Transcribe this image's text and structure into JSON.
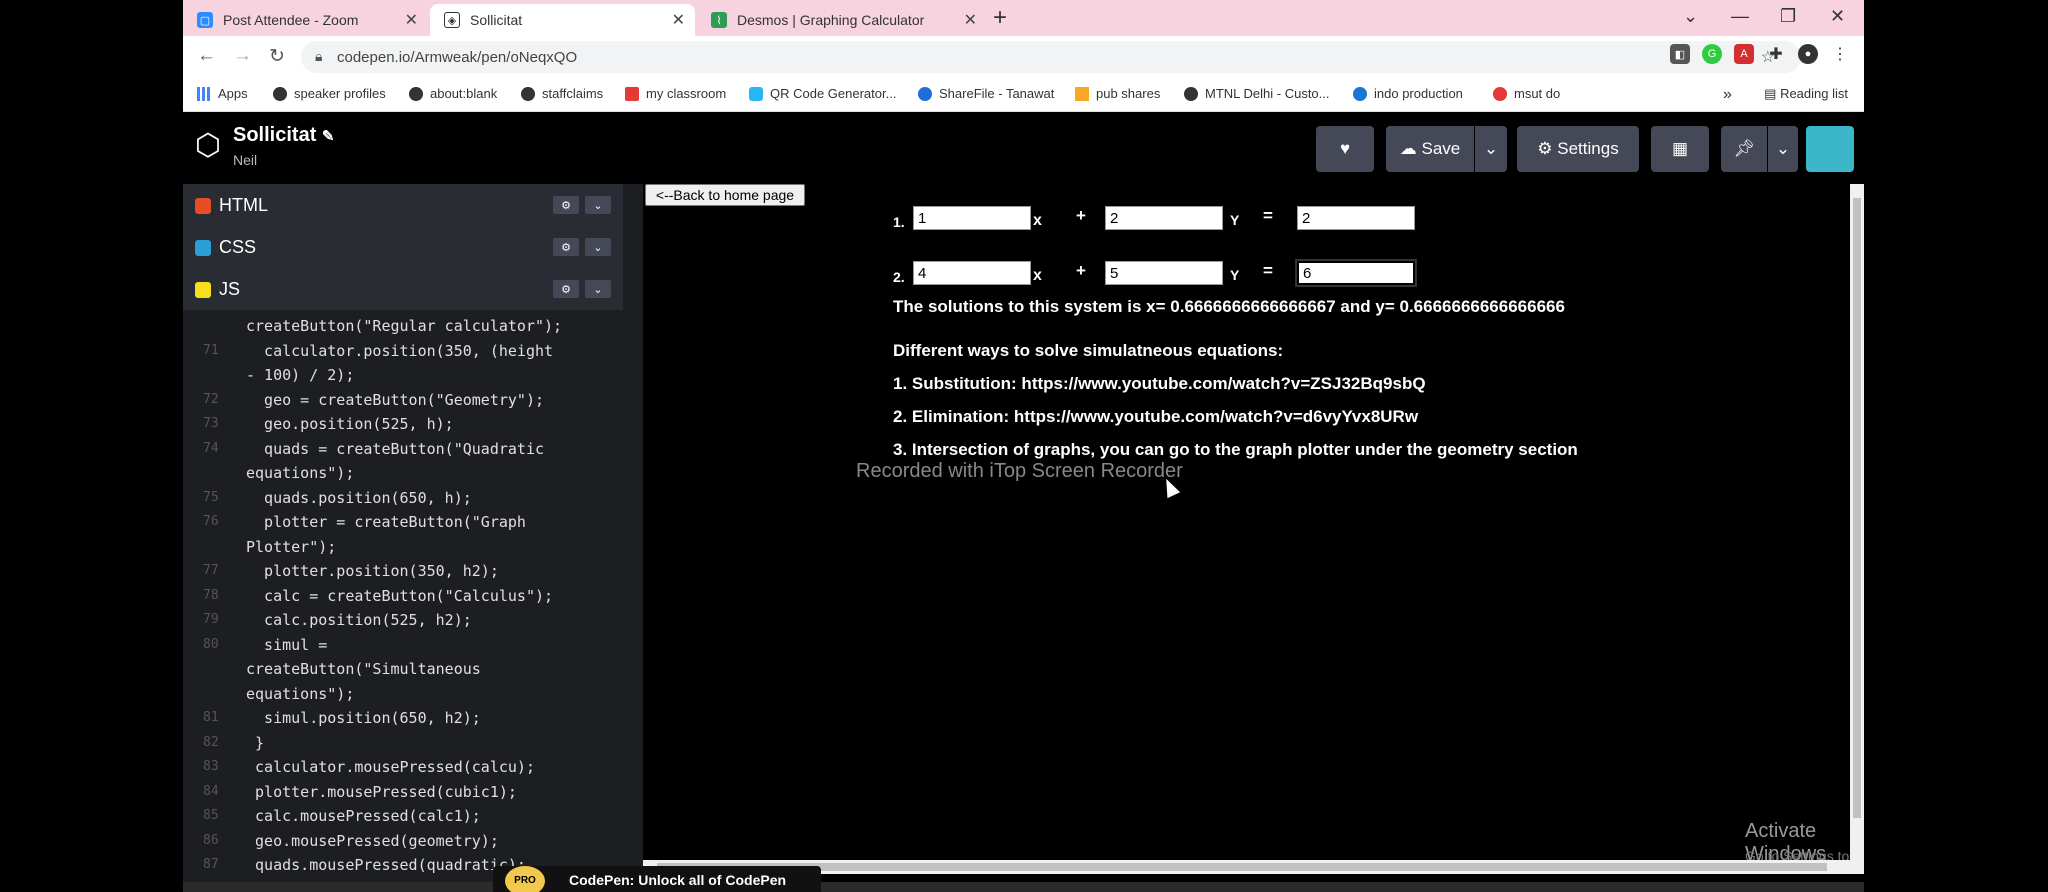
{
  "browser": {
    "tabs": [
      {
        "title": "Post Attendee - Zoom",
        "icon_color": "#2d8cff"
      },
      {
        "title": "Sollicitat",
        "icon_color": "#333333"
      },
      {
        "title": "Desmos | Graphing Calculator",
        "icon_color": "#2f9c56"
      }
    ],
    "url": "codepen.io/Armweak/pen/oNeqxQO",
    "bookmarks": [
      "Apps",
      "speaker profiles",
      "about:blank",
      "staffclaims",
      "my classroom",
      "QR Code Generator...",
      "ShareFile - Tanawat",
      "pub shares",
      "MTNL Delhi - Custo...",
      "indo production",
      "msut do"
    ],
    "bookmarks_more": "»",
    "reading_list": "Reading list"
  },
  "codepen": {
    "pen_title": "Sollicitat",
    "author": "Neil",
    "save_label": "Save",
    "settings_label": "Settings",
    "editors": {
      "html_label": "HTML",
      "css_label": "CSS",
      "js_label": "JS"
    },
    "code_lines": [
      {
        "num": "",
        "text": "createButton(\"Regular calculator\");"
      },
      {
        "num": "71",
        "text": "  calculator.position(350, (height"
      },
      {
        "num": "",
        "text": "- 100) / 2);"
      },
      {
        "num": "72",
        "text": "  geo = createButton(\"Geometry\");"
      },
      {
        "num": "73",
        "text": "  geo.position(525, h);"
      },
      {
        "num": "74",
        "text": "  quads = createButton(\"Quadratic"
      },
      {
        "num": "",
        "text": "equations\");"
      },
      {
        "num": "75",
        "text": "  quads.position(650, h);"
      },
      {
        "num": "76",
        "text": "  plotter = createButton(\"Graph"
      },
      {
        "num": "",
        "text": "Plotter\");"
      },
      {
        "num": "77",
        "text": "  plotter.position(350, h2);"
      },
      {
        "num": "78",
        "text": "  calc = createButton(\"Calculus\");"
      },
      {
        "num": "79",
        "text": "  calc.position(525, h2);"
      },
      {
        "num": "80",
        "text": "  simul ="
      },
      {
        "num": "",
        "text": "createButton(\"Simultaneous"
      },
      {
        "num": "",
        "text": "equations\");"
      },
      {
        "num": "81",
        "text": "  simul.position(650, h2);"
      },
      {
        "num": "82",
        "text": " }"
      },
      {
        "num": "83",
        "text": " calculator.mousePressed(calcu);"
      },
      {
        "num": "84",
        "text": " plotter.mousePressed(cubic1);"
      },
      {
        "num": "85",
        "text": " calc.mousePressed(calc1);"
      },
      {
        "num": "86",
        "text": " geo.mousePressed(geometry);"
      },
      {
        "num": "87",
        "text": " quads.mousePressed(quadratic);"
      }
    ]
  },
  "preview": {
    "back_button": "<--Back to home page",
    "eq1": {
      "num": "1.",
      "a": "1",
      "b": "2",
      "c": "2"
    },
    "eq2": {
      "num": "2.",
      "a": "4",
      "b": "5",
      "c": "6"
    },
    "sym_x": "x",
    "sym_plus": "+",
    "sym_y": "Y",
    "sym_eq": "=",
    "solution": "The solutions to this system is x= 0.6666666666666667 and y= 0.6666666666666666",
    "ways_heading": "Different ways to solve simulatneous equations:",
    "way1": "1. Substitution: https://www.youtube.com/watch?v=ZSJ32Bq9sbQ",
    "way2": "2. Elimination: https://www.youtube.com/watch?v=d6vyYvx8URw",
    "way3": "3. Intersection of graphs, you can go to the graph plotter under the geometry section"
  },
  "overlay": {
    "recorder_watermark": "Recorded with iTop Screen Recorder",
    "activate_title": "Activate Windows",
    "activate_sub": "Go to Settings to activate Windows.",
    "promo_text": "CodePen: Unlock all of CodePen"
  }
}
